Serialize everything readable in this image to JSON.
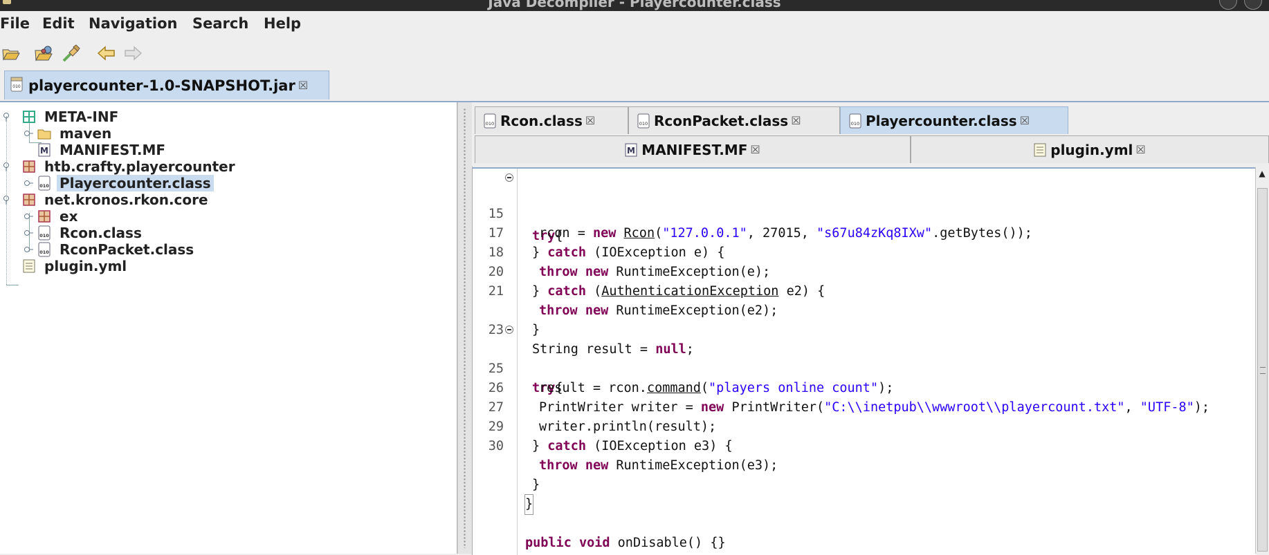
{
  "window": {
    "title": "Java Decompiler - Playercounter.class"
  },
  "menubar": {
    "items": [
      "File",
      "Edit",
      "Navigation",
      "Search",
      "Help"
    ]
  },
  "toolbar": {
    "icons": [
      "open-file-icon",
      "open-type-icon",
      "search-icon",
      "back-arrow-icon",
      "forward-arrow-icon"
    ]
  },
  "file_tab": {
    "label": "playercounter-1.0-SNAPSHOT.jar"
  },
  "tree": {
    "items": [
      {
        "label": "META-INF",
        "icon": "package-folder-icon"
      },
      {
        "label": "maven",
        "icon": "folder-icon"
      },
      {
        "label": "MANIFEST.MF",
        "icon": "manifest-icon"
      },
      {
        "label": "htb.crafty.playercounter",
        "icon": "package-icon"
      },
      {
        "label": "Playercounter.class",
        "icon": "class-file-icon"
      },
      {
        "label": "net.kronos.rkon.core",
        "icon": "package-icon"
      },
      {
        "label": "ex",
        "icon": "package-icon"
      },
      {
        "label": "Rcon.class",
        "icon": "class-file-icon"
      },
      {
        "label": "RconPacket.class",
        "icon": "class-file-icon"
      },
      {
        "label": "plugin.yml",
        "icon": "text-file-icon"
      }
    ],
    "selected": "Playercounter.class"
  },
  "class_tabs": {
    "row1": [
      "Rcon.class",
      "RconPacket.class",
      "Playercounter.class"
    ],
    "row2": [
      "MANIFEST.MF",
      "plugin.yml"
    ],
    "active": "Playercounter.class"
  },
  "code": {
    "line_numbers": [
      "",
      "15",
      "17",
      "18",
      "20",
      "21",
      "",
      "23",
      "",
      "25",
      "26",
      "27",
      "29",
      "30",
      "",
      "",
      "",
      "",
      ""
    ],
    "tokens": {
      "try": "try",
      "brace_open": "{",
      "brace_close": "}",
      "rcon_assign": "rcon = ",
      "new": "new",
      "rcon_type": "Rcon",
      "paren_open": "(",
      "host": "\"127.0.0.1\"",
      "port": ", 27015, ",
      "password": "\"s67u84zKq8IXw\"",
      "getbytes": ".getBytes());",
      "close_catch": "} ",
      "catch": "catch",
      "ioexception_e": " (IOException e) {",
      "throw": "throw",
      "runtime_e": " RuntimeException(e);",
      "auth_open": " (",
      "auth_type": "AuthenticationException",
      "auth_tail": " e2) {",
      "runtime_e2": " RuntimeException(e2);",
      "string_result": "String result = ",
      "null": "null",
      "semicolon": ";",
      "result_assign": "result = rcon.",
      "command": "command",
      "cmd_string": "\"players online count\"",
      "close_paren_semi": ");",
      "printwriter_decl": "PrintWriter writer = ",
      "printwriter_ctor": " PrintWriter(",
      "path_string": "\"C:\\\\inetpub\\\\wwwroot\\\\playercount.txt\"",
      "comma": ", ",
      "utf8": "\"UTF-8\"",
      "println": "writer.println(result);",
      "ioexception_e3": " (IOException e3) {",
      "runtime_e3": " RuntimeException(e3);",
      "public": "public",
      "void": "void",
      "ondisable": " onDisable() {}"
    }
  }
}
